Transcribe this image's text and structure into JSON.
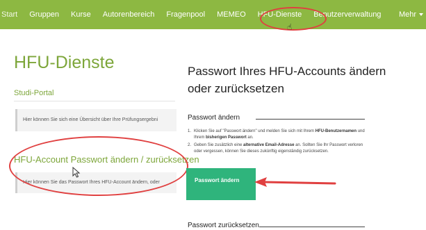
{
  "nav": {
    "items": [
      "Start",
      "Gruppen",
      "Kurse",
      "Autorenbereich",
      "Fragenpool",
      "MEMEO",
      "HFU-Dienste",
      "Benutzerverwaltung"
    ],
    "more_label": "Mehr"
  },
  "left": {
    "page_title": "HFU-Dienste",
    "studi_portal_label": "Studi-Portal",
    "studi_portal_desc": "Hier können Sie sich eine Übersicht über Ihre Prüfungsergebni",
    "pw_link_label": "HFU-Account Passwort ändern / zurücksetzen",
    "pw_desc": "Hier können Sie das Passwort Ihres HFU-Account ändern, oder"
  },
  "right": {
    "title": "Passwort Ihres HFU-Accounts ändern oder zurücksetzen",
    "change_heading": "Passwort ändern",
    "step1_num": "1.",
    "step1_a": "Klicken Sie auf \"Passwort ändern\" und melden Sie sich mit Ihrem ",
    "step1_b": "HFU-Benutzernamen",
    "step1_c": " und Ihrem ",
    "step1_d": "bisherigen Passwort",
    "step1_e": " an.",
    "step2_num": "2.",
    "step2_a": "Geben Sie zusätzlich eine ",
    "step2_b": "alternative Email-Adresse",
    "step2_c": " an. Sollten Sie Ihr Passwort verloren oder vergessen, können Sie dieses zukünftig eigenständig zurücksetzen.",
    "change_button_label": "Passwort ändern",
    "reset_heading": "Passwort zurücksetzen"
  },
  "colors": {
    "nav_bg": "#8db842",
    "accent_green": "#7da63a",
    "button_green": "#2fb47c",
    "annotation_red": "#e04040"
  }
}
